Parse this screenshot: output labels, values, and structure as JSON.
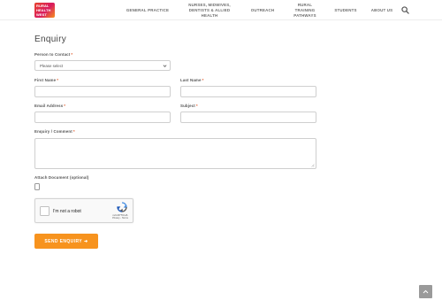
{
  "header": {
    "logo_lines": [
      "RURAL",
      "HEALTH",
      "WEST"
    ],
    "nav": {
      "general_practice": "GENERAL PRACTICE",
      "nurses_line1": "NURSES, MIDWIVES,",
      "nurses_line2": "DENTISTS & ALLIED",
      "nurses_line3": "HEALTH",
      "outreach": "OUTREACH",
      "rural_line1": "RURAL",
      "rural_line2": "TRAINING",
      "rural_line3": "PATHWAYS",
      "students": "STUDENTS",
      "about_us": "ABOUT US"
    }
  },
  "form": {
    "title": "Enquiry",
    "person_to_contact_label": "Person to Contact",
    "person_to_contact_value": "Please select",
    "first_name_label": "First Name",
    "last_name_label": "Last Name",
    "email_label": "Email Address",
    "subject_label": "Subject",
    "comment_label": "Enquiry / Comment",
    "attach_label": "Attach Document (optional)",
    "required_mark": "*",
    "recaptcha": {
      "label": "I'm not a robot",
      "brand": "reCAPTCHA",
      "terms": "Privacy - Terms"
    },
    "submit_label": "SEND ENQUIRY"
  },
  "colors": {
    "accent": "#f7931e",
    "required": "#e05a2b"
  }
}
